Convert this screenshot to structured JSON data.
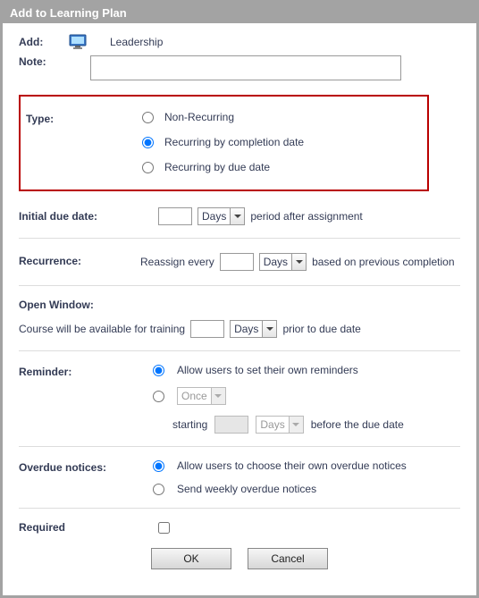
{
  "dialog": {
    "title": "Add to Learning Plan"
  },
  "header": {
    "add_label": "Add:",
    "item_name": "Leadership",
    "note_label": "Note:"
  },
  "type": {
    "label": "Type:",
    "options": {
      "non_recurring": "Non-Recurring",
      "by_completion": "Recurring by completion date",
      "by_due": "Recurring by due date"
    }
  },
  "initial_due": {
    "label": "Initial due date:",
    "unit": "Days",
    "suffix": "period after assignment"
  },
  "recurrence": {
    "label": "Recurrence:",
    "prefix": "Reassign every",
    "unit": "Days",
    "suffix": "based on previous completion"
  },
  "open_window": {
    "title": "Open Window:",
    "prefix": "Course will be available for training",
    "unit": "Days",
    "suffix": "prior to due date"
  },
  "reminder": {
    "label": "Reminder:",
    "allow_users": "Allow users to set their own reminders",
    "once": "Once",
    "starting": "starting",
    "unit": "Days",
    "suffix": "before the due date"
  },
  "overdue": {
    "label": "Overdue notices:",
    "allow_users": "Allow users to choose their own overdue notices",
    "weekly": "Send weekly overdue notices"
  },
  "required": {
    "label": "Required"
  },
  "buttons": {
    "ok": "OK",
    "cancel": "Cancel"
  }
}
